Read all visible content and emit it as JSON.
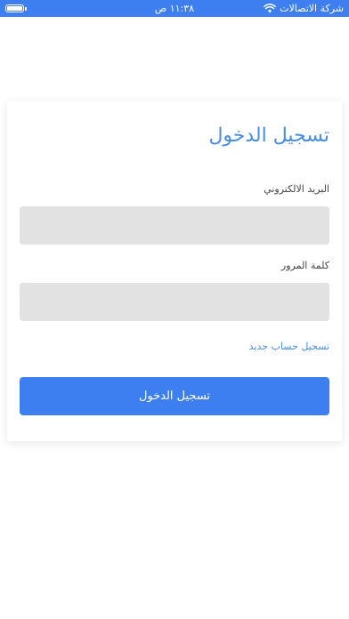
{
  "status_bar": {
    "carrier": "شركة الاتصالات",
    "time": "١١:٣٨ ص",
    "battery_level": 1.0,
    "background_color": "#3d7ff0",
    "icons": [
      "battery-icon",
      "wifi-icon"
    ]
  },
  "login": {
    "title": "تسجيل الدخول",
    "email_label": "البريد الالكتروني",
    "email_value": "",
    "password_label": "كلمة المرور",
    "password_value": "",
    "register_link": "تسجيل حساب جديد",
    "submit_label": "تسجيل الدخول"
  },
  "colors": {
    "accent": "#3d7ff0",
    "title": "#4a8ce0",
    "input_bg": "#e2e2e2"
  }
}
